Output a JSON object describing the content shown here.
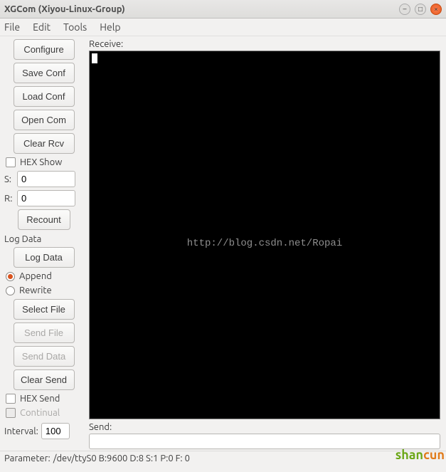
{
  "window": {
    "title": "XGCom (Xiyou-Linux-Group)"
  },
  "menu": {
    "file": "File",
    "edit": "Edit",
    "tools": "Tools",
    "help": "Help"
  },
  "sidebar": {
    "configure": "Configure",
    "save_conf": "Save Conf",
    "load_conf": "Load Conf",
    "open_com": "Open Com",
    "clear_rcv": "Clear Rcv",
    "hex_show": "HEX Show",
    "s_label": "S:",
    "s_value": "0",
    "r_label": "R:",
    "r_value": "0",
    "recount": "Recount",
    "log_section": "Log Data",
    "log_data": "Log Data",
    "append": "Append",
    "rewrite": "Rewrite",
    "select_file": "Select File",
    "send_file": "Send File",
    "send_data": "Send Data",
    "clear_send": "Clear Send",
    "hex_send": "HEX Send",
    "continual": "Continual",
    "interval_label": "Interval:",
    "interval_value": "100"
  },
  "main": {
    "receive_label": "Receive:",
    "watermark": "http://blog.csdn.net/Ropai",
    "send_label": "Send:",
    "send_value": ""
  },
  "status": {
    "label": "Parameter:",
    "value": "/dev/ttyS0 B:9600 D:8 S:1 P:0 F: 0"
  },
  "corner": {
    "a": "shan",
    "b": "cun"
  }
}
